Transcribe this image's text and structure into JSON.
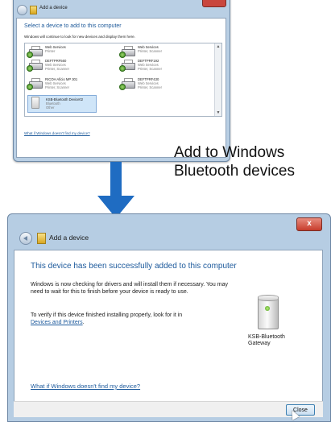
{
  "top_dialog": {
    "title": "Add a device",
    "heading": "Select a device to add to this computer",
    "description": "Windows will continue to look for new devices and display them here.",
    "devices": [
      {
        "name": "Web Services",
        "type": "Printer",
        "icon": "printer-icon"
      },
      {
        "name": "Web Services",
        "type": "Printer, Scanner",
        "icon": "printer-icon"
      },
      {
        "name": "DEFTPRF560",
        "line2": "Web Services",
        "type": "Printer, Scanner",
        "icon": "printer-icon"
      },
      {
        "name": "DEFTPRF192",
        "line2": "Web Services",
        "type": "Printer, Scanner",
        "icon": "printer-icon"
      },
      {
        "name": "RICOH Aficio MP 301",
        "line2": "Web Services",
        "type": "Printer, Scanner",
        "icon": "printer-icon"
      },
      {
        "name": "DEFTPRF430",
        "line2": "Web Services",
        "type": "Printer, Scanner",
        "icon": "printer-icon"
      },
      {
        "name": "KSB-Bluetooth Device02",
        "line2": "Bluetooth",
        "type": "Other",
        "icon": "bluetooth-device-icon",
        "selected": true
      }
    ],
    "help_link": "What if Windows doesn't find my device?"
  },
  "caption": {
    "line1": "Add to Windows",
    "line2": "Bluetooth devices"
  },
  "bottom_dialog": {
    "title": "Add a device",
    "close_glyph": "x",
    "heading": "This device has been successfully added to this computer",
    "paragraph1": "Windows is now checking for drivers and will install them if necessary. You may need to wait for this to finish before your device is ready to use.",
    "paragraph2_text": "To verify if this device finished installing properly, look for it in",
    "paragraph2_link": "Devices and Printers",
    "paragraph2_end": ".",
    "device_name_line1": "KSB-Bluetooth",
    "device_name_line2": "Gateway",
    "help_link": "What if Windows doesn't find my device?",
    "close_button": "Close"
  },
  "colors": {
    "arrow": "#1f6cc2",
    "heading_blue": "#1d5a9c",
    "window_frame": "#b6cde3"
  }
}
